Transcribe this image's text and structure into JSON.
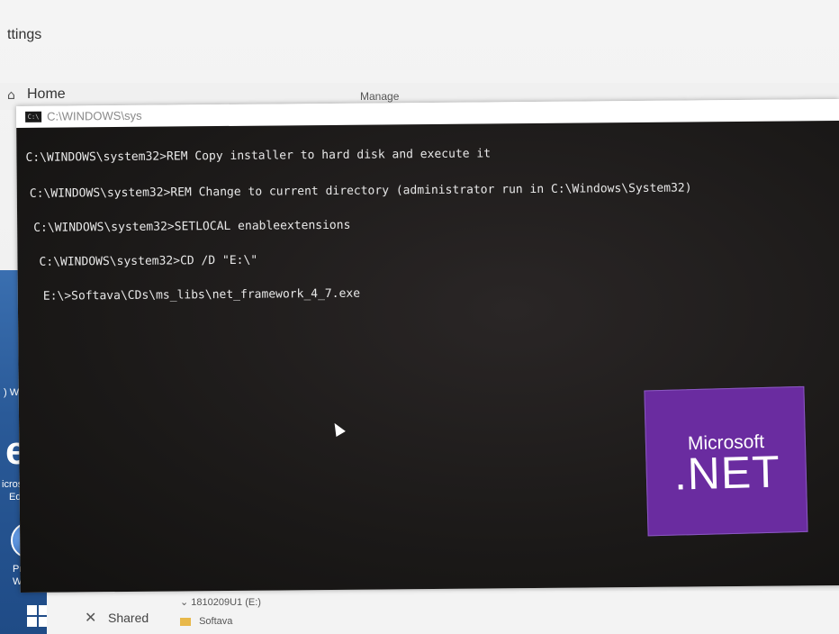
{
  "settings": {
    "title": "ttings"
  },
  "explorer": {
    "home": "Home",
    "manage": "Manage",
    "shared_label": "Shared",
    "drive_label": "1810209U1 (E:)",
    "folder_label": "Softava"
  },
  "desktop": {
    "edge_label_1": "icrosof",
    "edge_label_2": "Edge",
    "protected_label_1": "Protecte",
    "protected_label_2": "Workspac",
    "wifi_label": ") Wi"
  },
  "cmd": {
    "title": "C:\\WINDOWS\\sys",
    "lines": [
      "C:\\WINDOWS\\system32>REM Copy installer to hard disk and execute it",
      "C:\\WINDOWS\\system32>REM Change to current directory (administrator run in C:\\Windows\\System32)",
      "C:\\WINDOWS\\system32>SETLOCAL enableextensions",
      "C:\\WINDOWS\\system32>CD /D \"E:\\\"",
      "E:\\>Softava\\CDs\\ms_libs\\net_framework_4_7.exe"
    ]
  },
  "net_logo": {
    "microsoft": "Microsoft",
    "net": ".NET",
    "color": "#6a2ca0"
  },
  "icons": [
    "home-icon",
    "cmd-icon",
    "cursor-icon",
    "edge-icon",
    "globe-icon",
    "windows-logo-icon",
    "shared-icon",
    "folder-icon",
    "drive-icon"
  ]
}
